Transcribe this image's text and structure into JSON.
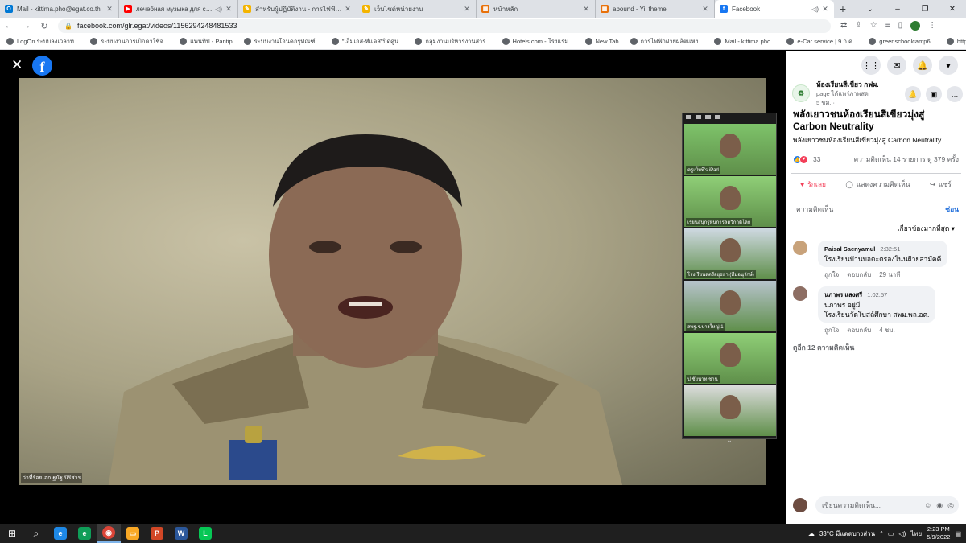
{
  "browser": {
    "tabs": [
      {
        "label": "Mail - kittima.pho@egat.co.th",
        "icon_color": "#0078d4",
        "icon_text": "O",
        "audio": false,
        "active": false
      },
      {
        "label": "лечебная музыка для серд",
        "icon_color": "#ff0000",
        "icon_text": "▶",
        "audio": true,
        "active": false
      },
      {
        "label": "สำหรับผู้ปฏิบัติงาน - การไฟฟ้าฝ่ายผลิ",
        "icon_color": "#f4b400",
        "icon_text": "✎",
        "audio": false,
        "active": false
      },
      {
        "label": "เว็บไซต์หน่วยงาน",
        "icon_color": "#f4b400",
        "icon_text": "✎",
        "audio": false,
        "active": false
      },
      {
        "label": "หน้าหลัก",
        "icon_color": "#e8710a",
        "icon_text": "▦",
        "audio": false,
        "active": false
      },
      {
        "label": "abound - Yii theme",
        "icon_color": "#e8710a",
        "icon_text": "▦",
        "audio": false,
        "active": false
      },
      {
        "label": "Facebook",
        "icon_color": "#1877f2",
        "icon_text": "f",
        "audio": true,
        "active": true
      }
    ],
    "url": "facebook.com/glr.egat/videos/1156294248481533",
    "bookmarks": [
      "LogOn ระบบลงเวลาท...",
      "ระบบงานการเบิกค่าใช้จ่...",
      "แพนทิป - Pantip",
      "ระบบงานโอนคอรุทัณฑ์...",
      "\"เอ็มเอส-ทีแคส\"ปิดศูน...",
      "กลุ่มงานบริหารงานสาร...",
      "Hotels.com - โรงแรม...",
      "New Tab",
      "การไฟฟ้าฝ่ายผลิตแห่ง...",
      "Mail - kittima.pho...",
      "e-Car service | 9 ก.ค...",
      "greenschoolcamp6...",
      "https://ssolb.egat.c..."
    ]
  },
  "video": {
    "speaker_label": "ว่าที่ร้อยเอก ฐนัฐ นิริสาร",
    "gallery": [
      {
        "name": "ครูเบิ้มพี่'s iPad",
        "bg": "#7ec36a"
      },
      {
        "name": "เรียนสนุกรู้ทันการลดวิกฤติโลก",
        "bg": "#8fcf77"
      },
      {
        "name": "โรงเรียนสตรีอยุธยา (ทีมอนุรักษ์)",
        "bg": "#cfd9e2"
      },
      {
        "name": "สพฐ.ร.บางใหญ่ 1",
        "bg": "#b7c3cc"
      },
      {
        "name": "ป ชัยนาท ชาน",
        "bg": "#8fcf77"
      },
      {
        "name": "",
        "bg": "#dcdcdc"
      }
    ]
  },
  "panel": {
    "page_name": "ห้องเรียนสีเขียว กฟผ.",
    "page_sub": "page ได้แพร่ภาพสด",
    "page_time": "5 ชม. ·",
    "post_title": "พลังเยาวชนห้องเรียนสีเขียวมุ่งสู่ Carbon Neutrality",
    "post_text": "พลังเยาวชนห้องเรียนสีเขียวมุ่งสู่ Carbon Neutrality",
    "reaction_count": "33",
    "comments_views": "ความคิดเห็น 14 รายการ  ดู 379 ครั้ง",
    "actions": {
      "like": "รักเลย",
      "comment": "แสดงความคิดเห็น",
      "share": "แชร์"
    },
    "comments_label": "ความคิดเห็น",
    "hide_label": "ซ่อน",
    "sort_label": "เกี่ยวข้องมากที่สุด ▾",
    "comments": [
      {
        "name": "Paisal Saenyamul",
        "time": "2:32:51",
        "text": "โรงเรียนบ้านบอดะตรองโนนฝ้ายสามัคคี",
        "like": "ถูกใจ",
        "reply": "ตอบกลับ",
        "ago": "29 นาที",
        "avatar": "#c8a27a"
      },
      {
        "name": "นภาพร แสงศรี",
        "time": "1:02:57",
        "text": "นภาพร อยู่มี\nโรงเรียนวัดโบสถ์ศึกษา สพม.พล.อต.",
        "like": "ถูกใจ",
        "reply": "ตอบกลับ",
        "ago": "4 ชม.",
        "avatar": "#8d6e63"
      }
    ],
    "more_comments": "ดูอีก 12 ความคิดเห็น",
    "composer_placeholder": "เขียนความคิดเห็น..."
  },
  "taskbar": {
    "weather": "33°C  มีแดดบางส่วน",
    "lang": "ไทย",
    "time": "2:23 PM",
    "date": "5/9/2022"
  }
}
